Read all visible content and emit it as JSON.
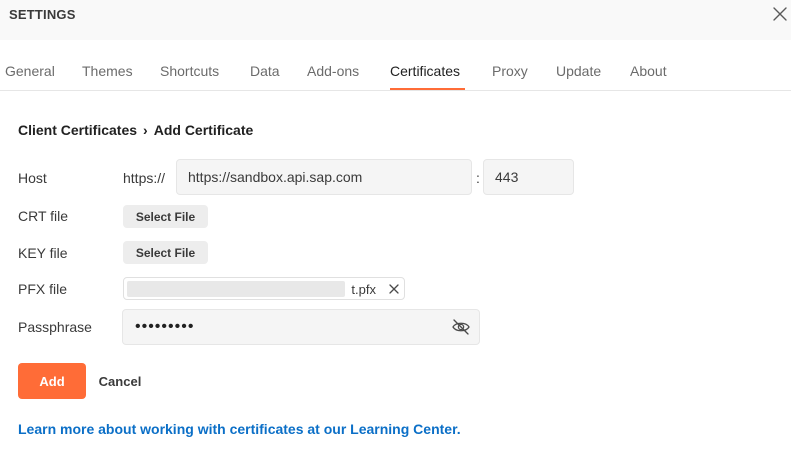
{
  "window": {
    "title": "SETTINGS",
    "close_icon": "close-icon"
  },
  "tabs": [
    {
      "label": "General",
      "active": false
    },
    {
      "label": "Themes",
      "active": false
    },
    {
      "label": "Shortcuts",
      "active": false
    },
    {
      "label": "Data",
      "active": false
    },
    {
      "label": "Add-ons",
      "active": false
    },
    {
      "label": "Certificates",
      "active": true
    },
    {
      "label": "Proxy",
      "active": false
    },
    {
      "label": "Update",
      "active": false
    },
    {
      "label": "About",
      "active": false
    }
  ],
  "breadcrumb": {
    "parent": "Client Certificates",
    "separator": "›",
    "current": "Add Certificate"
  },
  "form": {
    "host": {
      "label": "Host",
      "prefix": "https://",
      "value": "https://sandbox.api.sap.com",
      "port_separator": ":",
      "port": "443"
    },
    "crt": {
      "label": "CRT file",
      "button": "Select File"
    },
    "key": {
      "label": "KEY file",
      "button": "Select File"
    },
    "pfx": {
      "label": "PFX file",
      "file_name": "t.pfx",
      "remove_icon": "close-icon"
    },
    "passphrase": {
      "label": "Passphrase",
      "value": "•••••••••",
      "toggle_icon": "eye-slash-icon"
    }
  },
  "actions": {
    "add": "Add",
    "cancel": "Cancel"
  },
  "footer": {
    "learn_link": "Learn more about working with certificates at our Learning Center."
  },
  "colors": {
    "accent": "#ff6c37",
    "link": "#0b6fc7"
  }
}
